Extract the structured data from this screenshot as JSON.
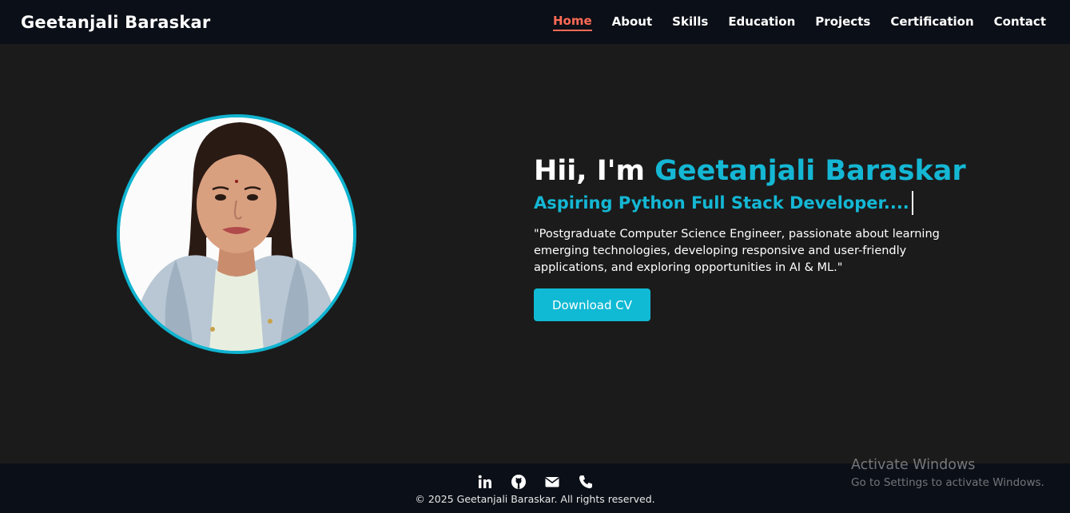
{
  "header": {
    "brand": "Geetanjali Baraskar",
    "nav": [
      {
        "label": "Home",
        "active": true
      },
      {
        "label": "About",
        "active": false
      },
      {
        "label": "Skills",
        "active": false
      },
      {
        "label": "Education",
        "active": false
      },
      {
        "label": "Projects",
        "active": false
      },
      {
        "label": "Certification",
        "active": false
      },
      {
        "label": "Contact",
        "active": false
      }
    ]
  },
  "hero": {
    "greeting": "Hii, I'm ",
    "name": "Geetanjali Baraskar",
    "subtitle": "Aspiring Python Full Stack Developer....",
    "description": "\"Postgraduate Computer Science Engineer, passionate about learning emerging technologies, developing responsive and user-friendly applications, and exploring opportunities in AI & ML.\"",
    "cta_label": "Download CV"
  },
  "footer": {
    "social": [
      {
        "icon": "linkedin-icon"
      },
      {
        "icon": "github-icon"
      },
      {
        "icon": "envelope-icon"
      },
      {
        "icon": "phone-icon"
      }
    ],
    "copyright": "© 2025 Geetanjali Baraskar. All rights reserved."
  },
  "watermark": {
    "title": "Activate Windows",
    "subtitle": "Go to Settings to activate Windows."
  },
  "colors": {
    "accent": "#14b7d4",
    "active_nav": "#ff6b57",
    "background": "#1b1b1b",
    "navbar": "#0b0f17"
  }
}
